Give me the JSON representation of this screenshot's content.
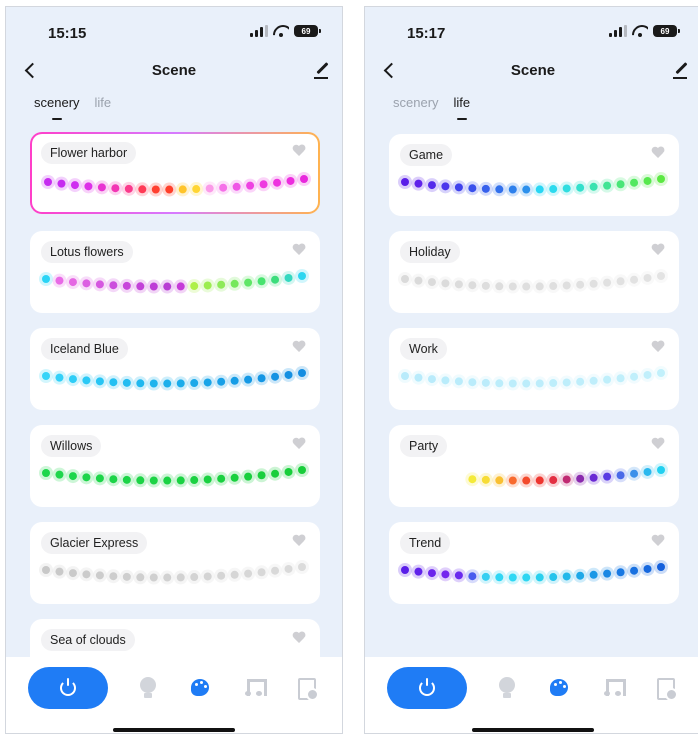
{
  "screens": [
    {
      "status": {
        "time": "15:15",
        "battery": "69"
      },
      "nav": {
        "title": "Scene"
      },
      "tabs": [
        {
          "label": "scenery",
          "active": true
        },
        {
          "label": "life",
          "active": false
        }
      ],
      "cards": [
        {
          "label": "Flower harbor",
          "selected": true,
          "dots": [
            "#c62cf0",
            "#c62cf0",
            "#cf2ef0",
            "#dd30e8",
            "#e834d2",
            "#f236b4",
            "#fa3a8c",
            "#ff3a55",
            "#ff4030",
            "#ff3f2a",
            "#ffc42a",
            "#ffd534",
            "#fb9ae8",
            "#f570e8",
            "#ef55e6",
            "#ee42e2",
            "#ee38e0",
            "#ee32df",
            "#ec2cdd",
            "#e828dc"
          ]
        },
        {
          "label": "Lotus flowers",
          "selected": false,
          "dots": [
            "#2bd4f5",
            "#e86ae6",
            "#e567e3",
            "#dc5ee2",
            "#d557e0",
            "#cc4ddd",
            "#c846db",
            "#c241d8",
            "#bd3ed6",
            "#b83cd4",
            "#c53ad8",
            "#aef04a",
            "#9ced50",
            "#8eea58",
            "#75e85c",
            "#5fe666",
            "#47e36e",
            "#3cdd7c",
            "#35d8c0",
            "#2ed6f0"
          ]
        },
        {
          "label": "Iceland Blue",
          "selected": false,
          "dots": [
            "#36d4f8",
            "#32d0f8",
            "#2ecdf7",
            "#2ac9f6",
            "#27c5f4",
            "#24c0f2",
            "#22bcf1",
            "#20b8ef",
            "#1eb4ed",
            "#1cb0eb",
            "#1bacea",
            "#1aa8e9",
            "#19a4e8",
            "#18a0e7",
            "#179de6",
            "#1699e5",
            "#1596e4",
            "#1593e3",
            "#1490e2",
            "#138de1"
          ]
        },
        {
          "label": "Willows",
          "selected": false,
          "dots": [
            "#1ed64c",
            "#1ed64c",
            "#1dd64b",
            "#1dd54a",
            "#1dd549",
            "#1dd448",
            "#1cd447",
            "#1cd346",
            "#1cd345",
            "#1bd244",
            "#1bd243",
            "#1bd142",
            "#1ad141",
            "#1ad040",
            "#1ad03f",
            "#19cf3e",
            "#19cf3d",
            "#19ce3c",
            "#18ce3b",
            "#18cd3a"
          ]
        },
        {
          "label": "Glacier Express",
          "selected": false,
          "dots": [
            "#c8c8c8",
            "#c9c9c9",
            "#cacaca",
            "#cbcbcb",
            "#cccccc",
            "#cdcdcd",
            "#cecece",
            "#cfcfcf",
            "#d0d0d0",
            "#d1d1d1",
            "#d2d2d2",
            "#d3d3d3",
            "#d4d4d4",
            "#d5d5d5",
            "#d6d6d6",
            "#d7d7d7",
            "#d8d8d8",
            "#d9d9d9",
            "#dadada",
            "#dbdbdb"
          ]
        },
        {
          "label": "Sea of clouds",
          "selected": false,
          "dots": []
        }
      ]
    },
    {
      "status": {
        "time": "15:17",
        "battery": "69"
      },
      "nav": {
        "title": "Scene"
      },
      "tabs": [
        {
          "label": "scenery",
          "active": false
        },
        {
          "label": "life",
          "active": true
        }
      ],
      "cards": [
        {
          "label": "Game",
          "selected": false,
          "dots": [
            "#5a1ee8",
            "#6022ea",
            "#552aeb",
            "#4a36ec",
            "#4042ec",
            "#3a50ec",
            "#3660ec",
            "#3270ec",
            "#2e80ec",
            "#2c90ec",
            "#28d6f4",
            "#2cdaee",
            "#30dde0",
            "#34e0cc",
            "#3ae2b0",
            "#42e494",
            "#4ae678",
            "#52e860",
            "#58e84e",
            "#5ce842"
          ]
        },
        {
          "label": "Holiday",
          "selected": false,
          "dots": [
            "#dadada",
            "#dadada",
            "#dbdbdb",
            "#dbdbdb",
            "#dcdcdc",
            "#dcdcdc",
            "#dddddd",
            "#dddddd",
            "#dedede",
            "#dedede",
            "#dedede",
            "#dfdfdf",
            "#dfdfdf",
            "#e0e0e0",
            "#e0e0e0",
            "#e1e1e1",
            "#e1e1e1",
            "#e2e2e2",
            "#e2e2e2",
            "#e3e3e3"
          ]
        },
        {
          "label": "Work",
          "selected": false,
          "dots": [
            "#b8ebfb",
            "#b8ebfb",
            "#b9ebfb",
            "#b9ecfb",
            "#baecfb",
            "#baecfb",
            "#bbecfb",
            "#bbedfb",
            "#bcedfb",
            "#bcedfb",
            "#bdedfb",
            "#bdeefb",
            "#beeefb",
            "#beeefb",
            "#bfeefb",
            "#bfeffb",
            "#c0effb",
            "#c0effb",
            "#c1effb",
            "#c1f0fb"
          ]
        },
        {
          "label": "Party",
          "selected": false,
          "dots": [
            "",
            "",
            "",
            "",
            "",
            "#f4ea3a",
            "#f7dc36",
            "#f9c032",
            "#f86a2e",
            "#f34a2c",
            "#ee362f",
            "#e32f42",
            "#c02a72",
            "#8a2aae",
            "#6a2ad4",
            "#5a3ae4",
            "#4a6ae8",
            "#3a90ea",
            "#2ab8ee",
            "#22d0f0"
          ]
        },
        {
          "label": "Trend",
          "selected": false,
          "dots": [
            "#5a1ee8",
            "#6022ea",
            "#6b24ec",
            "#7426ee",
            "#6a2aee",
            "#4a5cee",
            "#34cff2",
            "#30d6f4",
            "#2fd8f4",
            "#2ed6f2",
            "#2ad0ee",
            "#26c4ec",
            "#22b8ea",
            "#1ea8e8",
            "#1a98e6",
            "#1a88e4",
            "#1878e2",
            "#1870e0",
            "#1668de",
            "#1460dc"
          ]
        }
      ]
    }
  ]
}
